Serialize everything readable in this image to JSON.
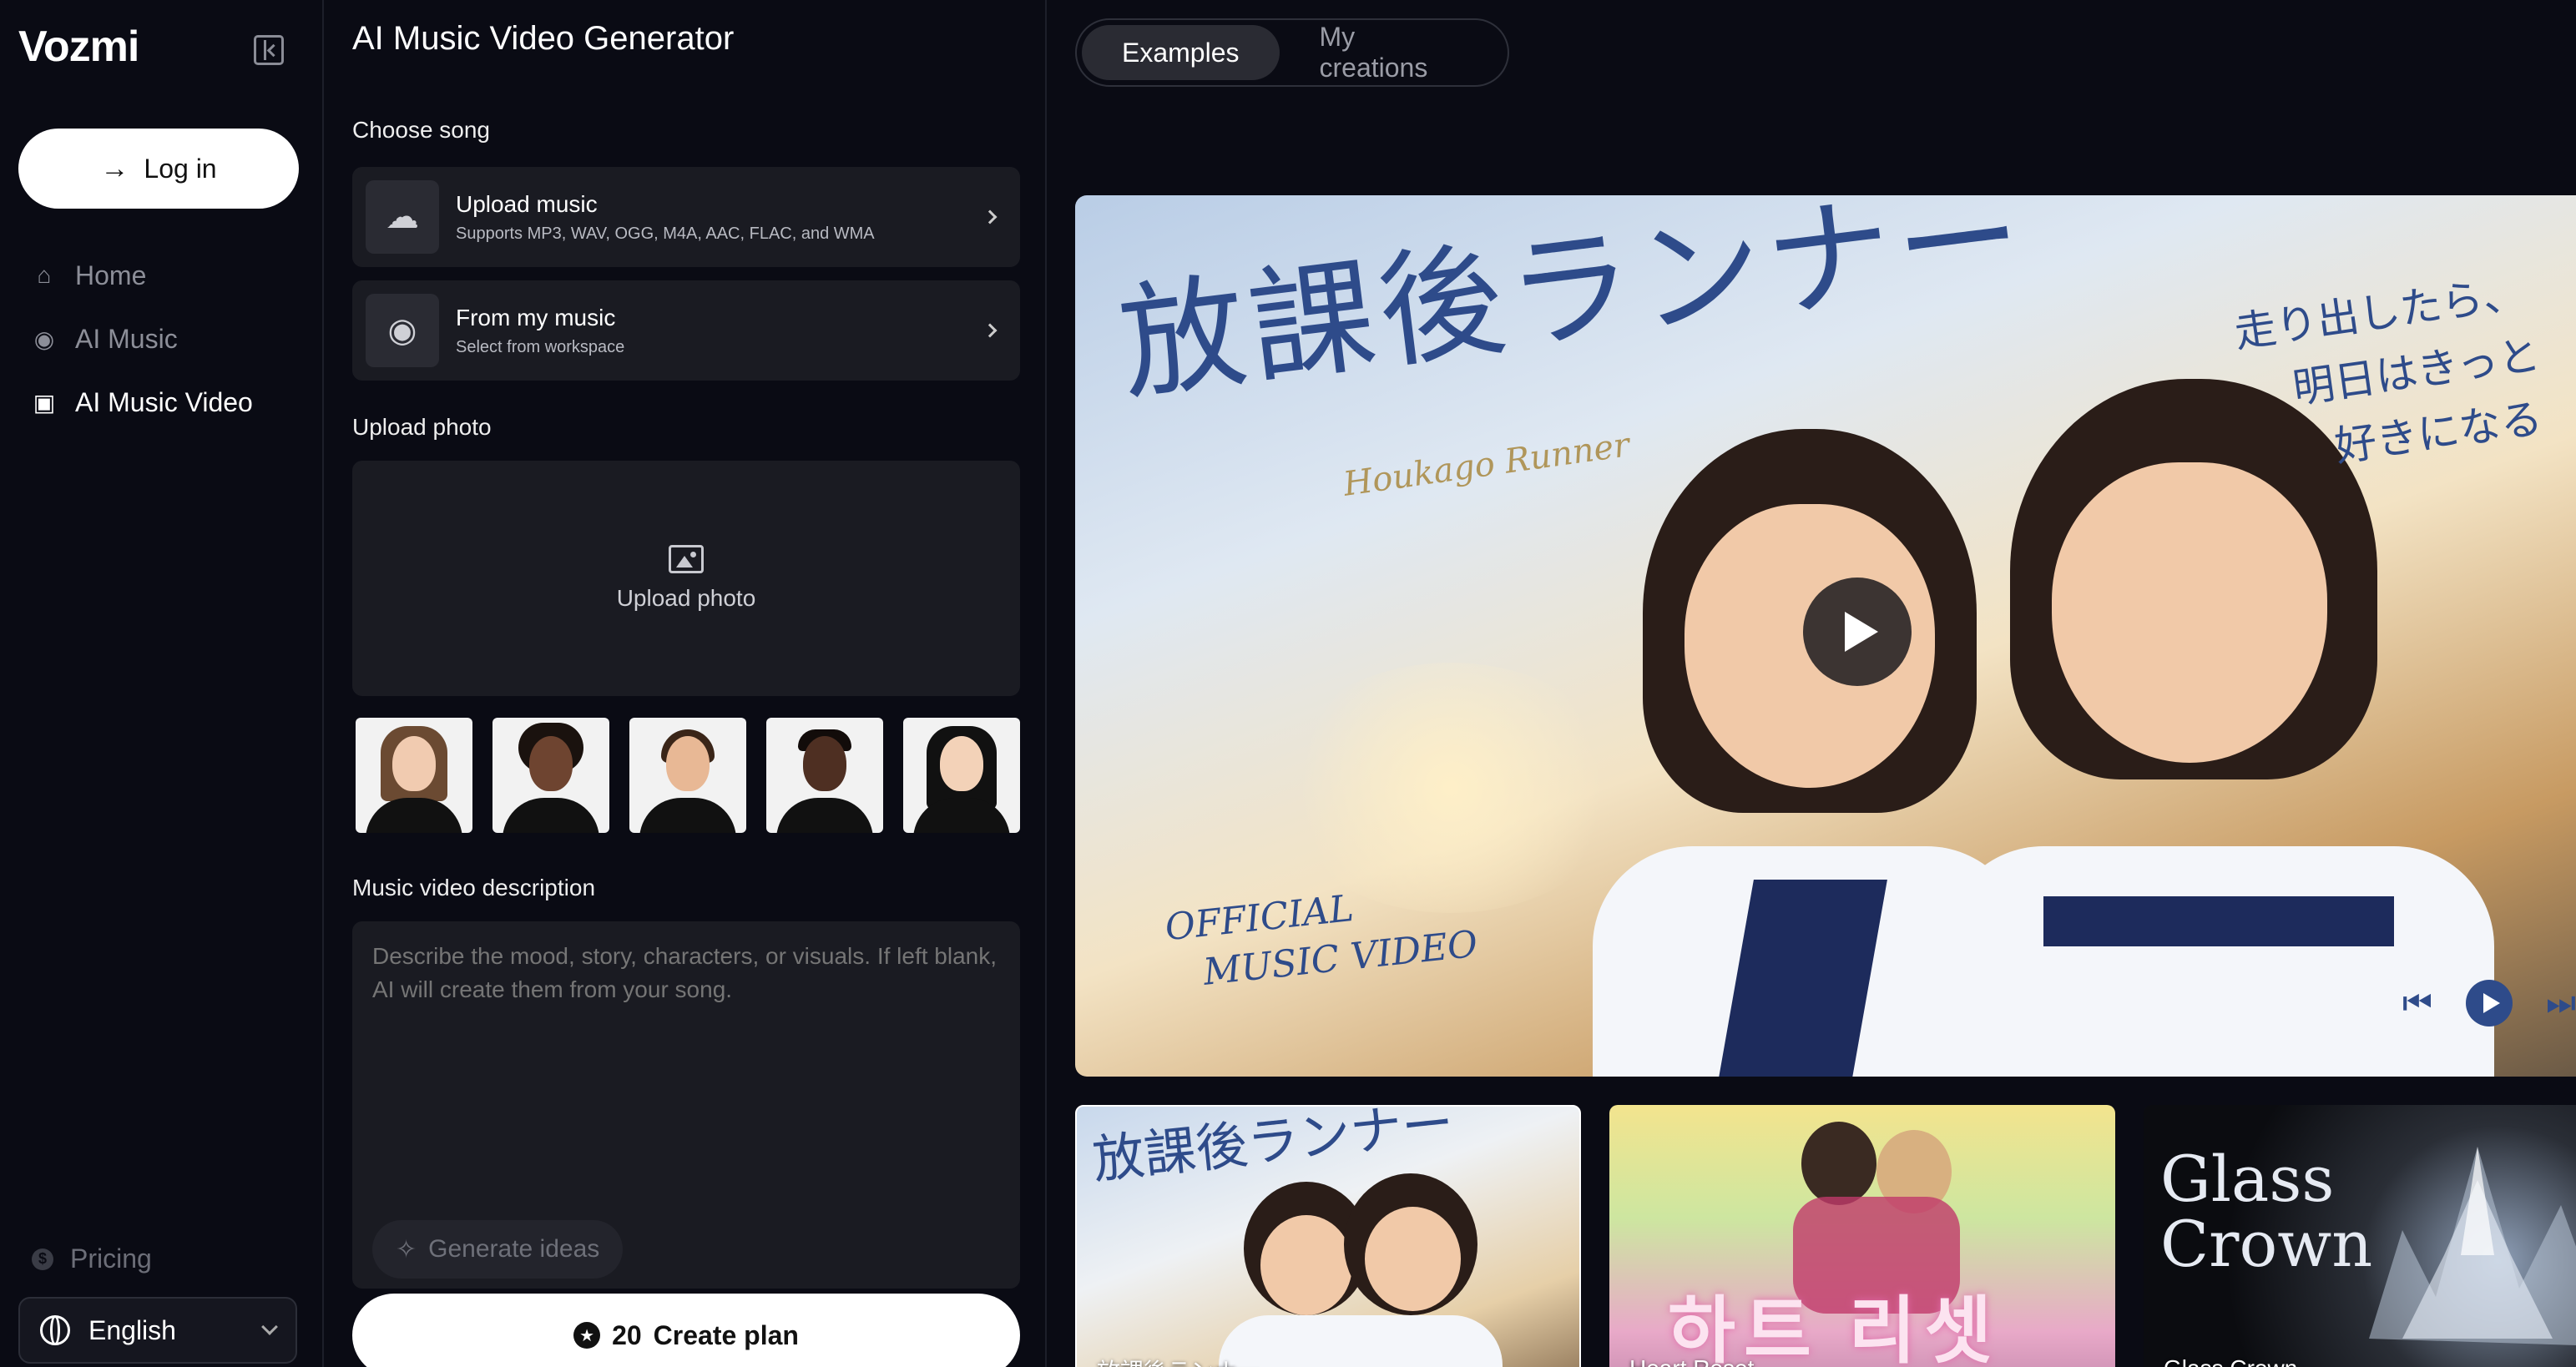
{
  "sidebar": {
    "brand": "Vozmi",
    "login_label": "Log in",
    "nav": [
      {
        "label": "Home",
        "icon": "home-icon"
      },
      {
        "label": "AI Music",
        "icon": "music-disc-icon"
      },
      {
        "label": "AI Music Video",
        "icon": "video-icon"
      }
    ],
    "pricing_label": "Pricing",
    "language": "English"
  },
  "form": {
    "title": "AI Music Video Generator",
    "choose_song_label": "Choose song",
    "upload_music": {
      "title": "Upload music",
      "subtitle": "Supports MP3, WAV, OGG, M4A, AAC, FLAC, and WMA"
    },
    "from_my_music": {
      "title": "From my music",
      "subtitle": "Select from workspace"
    },
    "upload_photo_label": "Upload photo",
    "upload_photo_button": "Upload photo",
    "description_label": "Music video description",
    "description_placeholder": "Describe the mood, story, characters, or visuals. If left blank, AI will create them from your song.",
    "generate_ideas_label": "Generate ideas",
    "create_cost": "20",
    "create_label": "Create plan"
  },
  "gallery": {
    "tabs": [
      "Examples",
      "My creations"
    ],
    "active_tab": "Examples",
    "hero": {
      "title_jp": "放課後ランナー",
      "title_en": "Houkago Runner",
      "side_text": [
        "走り出したら、",
        "明日はきっと",
        "好きになる"
      ],
      "badge_line1": "OFFICIAL",
      "badge_line2": "MUSIC VIDEO"
    },
    "thumbnails": [
      {
        "title": "放課後ランナー",
        "art_text": "放課後ランナー"
      },
      {
        "title": "Heart Reset",
        "art_text": "하트 리셋"
      },
      {
        "title": "Glass Crown",
        "art_text_line1": "Glass",
        "art_text_line2": "Crown"
      }
    ]
  }
}
